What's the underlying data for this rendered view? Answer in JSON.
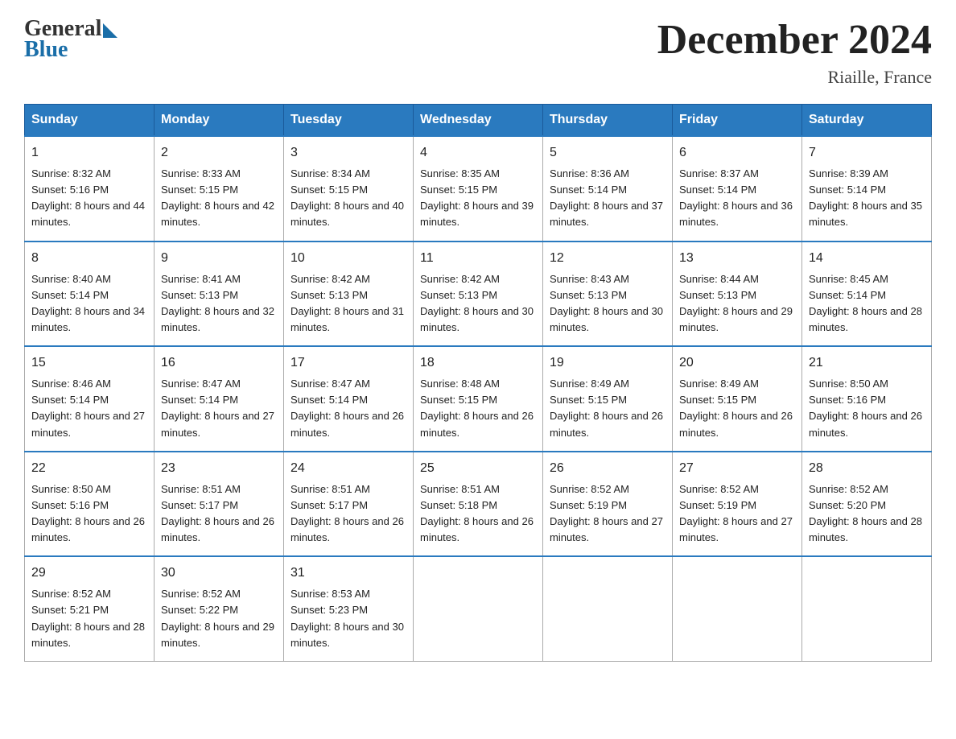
{
  "logo": {
    "general": "General",
    "blue": "Blue"
  },
  "title": "December 2024",
  "location": "Riaille, France",
  "days_header": [
    "Sunday",
    "Monday",
    "Tuesday",
    "Wednesday",
    "Thursday",
    "Friday",
    "Saturday"
  ],
  "weeks": [
    [
      {
        "day": "1",
        "sunrise": "8:32 AM",
        "sunset": "5:16 PM",
        "daylight": "8 hours and 44 minutes."
      },
      {
        "day": "2",
        "sunrise": "8:33 AM",
        "sunset": "5:15 PM",
        "daylight": "8 hours and 42 minutes."
      },
      {
        "day": "3",
        "sunrise": "8:34 AM",
        "sunset": "5:15 PM",
        "daylight": "8 hours and 40 minutes."
      },
      {
        "day": "4",
        "sunrise": "8:35 AM",
        "sunset": "5:15 PM",
        "daylight": "8 hours and 39 minutes."
      },
      {
        "day": "5",
        "sunrise": "8:36 AM",
        "sunset": "5:14 PM",
        "daylight": "8 hours and 37 minutes."
      },
      {
        "day": "6",
        "sunrise": "8:37 AM",
        "sunset": "5:14 PM",
        "daylight": "8 hours and 36 minutes."
      },
      {
        "day": "7",
        "sunrise": "8:39 AM",
        "sunset": "5:14 PM",
        "daylight": "8 hours and 35 minutes."
      }
    ],
    [
      {
        "day": "8",
        "sunrise": "8:40 AM",
        "sunset": "5:14 PM",
        "daylight": "8 hours and 34 minutes."
      },
      {
        "day": "9",
        "sunrise": "8:41 AM",
        "sunset": "5:13 PM",
        "daylight": "8 hours and 32 minutes."
      },
      {
        "day": "10",
        "sunrise": "8:42 AM",
        "sunset": "5:13 PM",
        "daylight": "8 hours and 31 minutes."
      },
      {
        "day": "11",
        "sunrise": "8:42 AM",
        "sunset": "5:13 PM",
        "daylight": "8 hours and 30 minutes."
      },
      {
        "day": "12",
        "sunrise": "8:43 AM",
        "sunset": "5:13 PM",
        "daylight": "8 hours and 30 minutes."
      },
      {
        "day": "13",
        "sunrise": "8:44 AM",
        "sunset": "5:13 PM",
        "daylight": "8 hours and 29 minutes."
      },
      {
        "day": "14",
        "sunrise": "8:45 AM",
        "sunset": "5:14 PM",
        "daylight": "8 hours and 28 minutes."
      }
    ],
    [
      {
        "day": "15",
        "sunrise": "8:46 AM",
        "sunset": "5:14 PM",
        "daylight": "8 hours and 27 minutes."
      },
      {
        "day": "16",
        "sunrise": "8:47 AM",
        "sunset": "5:14 PM",
        "daylight": "8 hours and 27 minutes."
      },
      {
        "day": "17",
        "sunrise": "8:47 AM",
        "sunset": "5:14 PM",
        "daylight": "8 hours and 26 minutes."
      },
      {
        "day": "18",
        "sunrise": "8:48 AM",
        "sunset": "5:15 PM",
        "daylight": "8 hours and 26 minutes."
      },
      {
        "day": "19",
        "sunrise": "8:49 AM",
        "sunset": "5:15 PM",
        "daylight": "8 hours and 26 minutes."
      },
      {
        "day": "20",
        "sunrise": "8:49 AM",
        "sunset": "5:15 PM",
        "daylight": "8 hours and 26 minutes."
      },
      {
        "day": "21",
        "sunrise": "8:50 AM",
        "sunset": "5:16 PM",
        "daylight": "8 hours and 26 minutes."
      }
    ],
    [
      {
        "day": "22",
        "sunrise": "8:50 AM",
        "sunset": "5:16 PM",
        "daylight": "8 hours and 26 minutes."
      },
      {
        "day": "23",
        "sunrise": "8:51 AM",
        "sunset": "5:17 PM",
        "daylight": "8 hours and 26 minutes."
      },
      {
        "day": "24",
        "sunrise": "8:51 AM",
        "sunset": "5:17 PM",
        "daylight": "8 hours and 26 minutes."
      },
      {
        "day": "25",
        "sunrise": "8:51 AM",
        "sunset": "5:18 PM",
        "daylight": "8 hours and 26 minutes."
      },
      {
        "day": "26",
        "sunrise": "8:52 AM",
        "sunset": "5:19 PM",
        "daylight": "8 hours and 27 minutes."
      },
      {
        "day": "27",
        "sunrise": "8:52 AM",
        "sunset": "5:19 PM",
        "daylight": "8 hours and 27 minutes."
      },
      {
        "day": "28",
        "sunrise": "8:52 AM",
        "sunset": "5:20 PM",
        "daylight": "8 hours and 28 minutes."
      }
    ],
    [
      {
        "day": "29",
        "sunrise": "8:52 AM",
        "sunset": "5:21 PM",
        "daylight": "8 hours and 28 minutes."
      },
      {
        "day": "30",
        "sunrise": "8:52 AM",
        "sunset": "5:22 PM",
        "daylight": "8 hours and 29 minutes."
      },
      {
        "day": "31",
        "sunrise": "8:53 AM",
        "sunset": "5:23 PM",
        "daylight": "8 hours and 30 minutes."
      },
      null,
      null,
      null,
      null
    ]
  ],
  "labels": {
    "sunrise": "Sunrise: ",
    "sunset": "Sunset: ",
    "daylight": "Daylight: "
  }
}
